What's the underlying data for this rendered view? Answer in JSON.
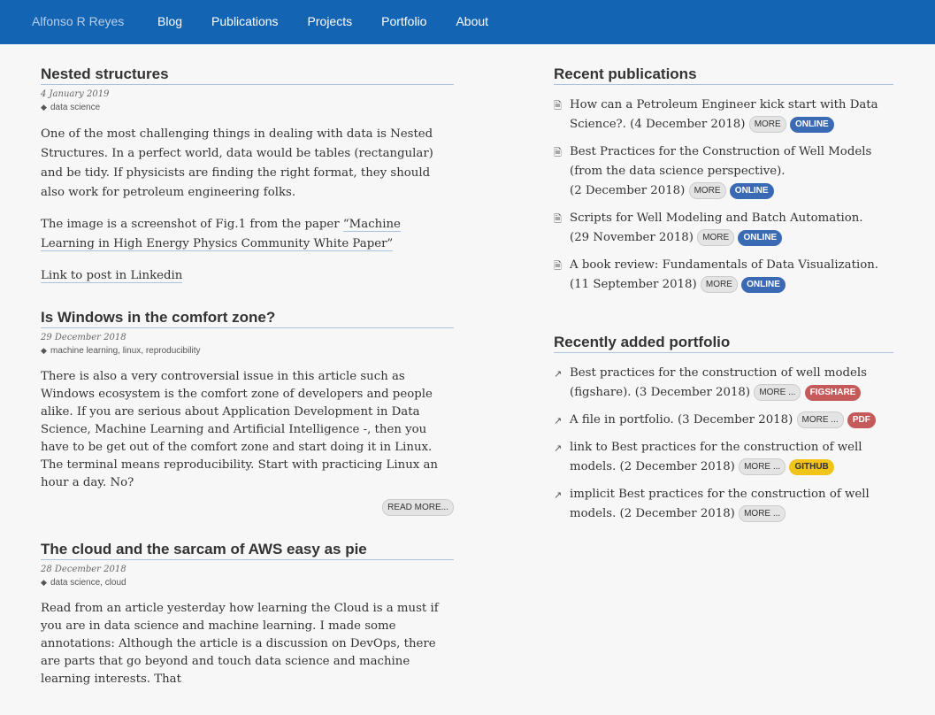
{
  "header": {
    "brand": "Alfonso R Reyes",
    "nav": [
      "Blog",
      "Publications",
      "Projects",
      "Portfolio",
      "About"
    ]
  },
  "posts": [
    {
      "title": "Nested structures",
      "date": "4 January 2019",
      "tags": "data science",
      "p1": "One of the most challenging things in dealing with data is Nested Structures. In a perfect world, data would be tables (rectangular) and be tidy. If physicists are finding the right format, they should also work for petroleum engineering folks.",
      "p2_pre": "The image is a screenshot of Fig.1 from the paper ",
      "p2_link": "“Machine Learning in High Energy Physics Community White Paper”",
      "p3_link": "Link to post in Linkedin"
    },
    {
      "title": "Is Windows in the comfort zone?",
      "date": "29 December 2018",
      "tags": "machine learning, linux, reproducibility",
      "p1": "There is also a very controversial issue in this article such as Windows ecosystem is the comfort zone of developers and people alike. If you are serious about Application Development in Data Science, Machine Learning and Artificial Intelligence -, then you have to be get out of the comfort zone and start doing it in Linux. The terminal means reproducibility. Start with practicing Linux an hour a day. No?",
      "readmore": "READ MORE..."
    },
    {
      "title": "The cloud and the sarcam of AWS easy as pie",
      "date": "28 December 2018",
      "tags": "data science, cloud",
      "p1": "Read from an article yesterday how learning the Cloud is a must if you are in data science and machine learning. I made some annotations: Although the article is a discussion on DevOps, there are parts that go beyond and touch data science and machine learning interests. That"
    }
  ],
  "recent_publications": {
    "title": "Recent publications",
    "items": [
      {
        "text": "How can a Petroleum Engineer kick start with Data Science?. (4 December 2018)",
        "more": "MORE",
        "badge": "ONLINE"
      },
      {
        "text": "Best Practices for the Construction of Well Models (from the data science perspective).",
        "text2": "(2 December 2018)",
        "more": "MORE",
        "badge": "ONLINE"
      },
      {
        "text": "Scripts for Well Modeling and Batch Automation.",
        "text2": "(29 November 2018)",
        "more": "MORE",
        "badge": "ONLINE"
      },
      {
        "text": "A book review: Fundamentals of Data Visualization.",
        "text2": "(11 September 2018)",
        "more": "MORE",
        "badge": "ONLINE"
      }
    ]
  },
  "recent_portfolio": {
    "title": "Recently added portfolio",
    "items": [
      {
        "text": "Best practices for the construction of well models (figshare). (3 December 2018)",
        "more": "MORE ...",
        "badge": "FIGSHARE"
      },
      {
        "text": "A file in portfolio. (3 December 2018)",
        "more": "MORE ...",
        "badge": "PDF"
      },
      {
        "text": "link to Best practices for the construction of well models. (2 December 2018)",
        "more": "MORE ...",
        "badge": "GITHUB"
      },
      {
        "text": "implicit Best practices for the construction of well models. (2 December 2018)",
        "more": "MORE ..."
      }
    ]
  },
  "icons": {
    "tag": "tags-icon",
    "publication": "file-icon",
    "portfolio": "chart-line-icon"
  }
}
